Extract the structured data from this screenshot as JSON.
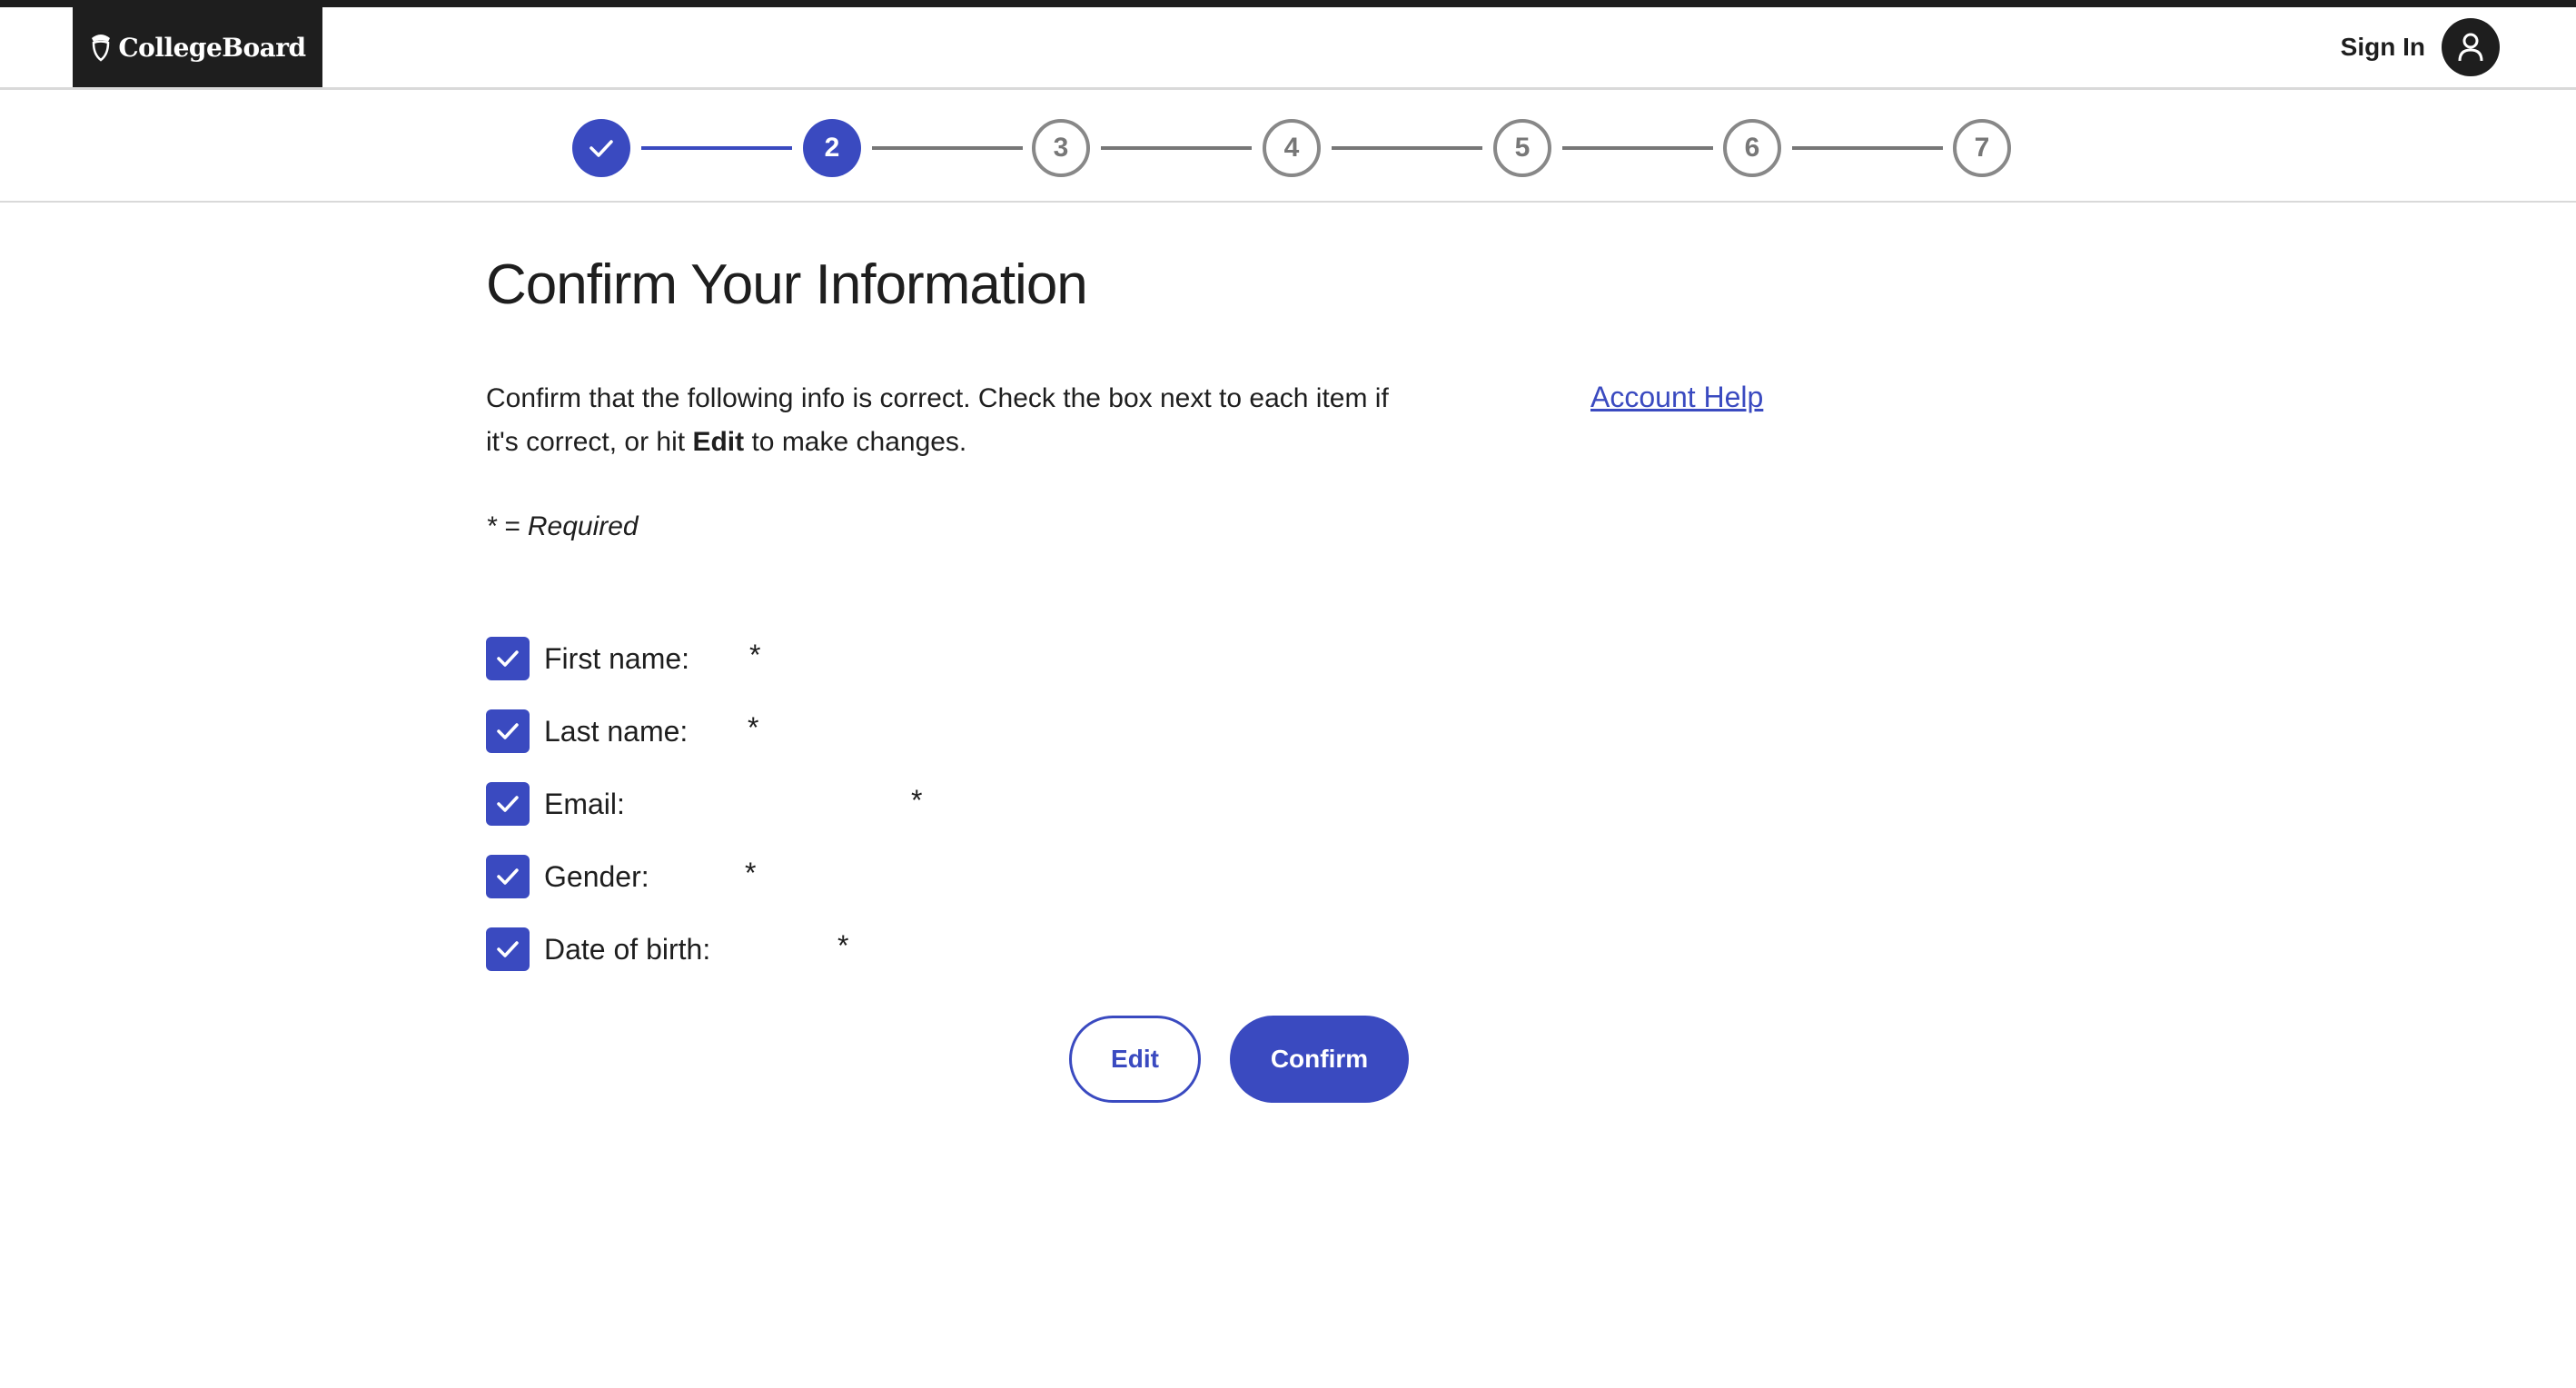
{
  "header": {
    "logo_text": "CollegeBoard",
    "sign_in_label": "Sign In"
  },
  "stepper": {
    "current_step": 2,
    "total_steps": 7,
    "steps": [
      {
        "label": "",
        "state": "done"
      },
      {
        "label": "2",
        "state": "current"
      },
      {
        "label": "3",
        "state": "future"
      },
      {
        "label": "4",
        "state": "future"
      },
      {
        "label": "5",
        "state": "future"
      },
      {
        "label": "6",
        "state": "future"
      },
      {
        "label": "7",
        "state": "future"
      }
    ]
  },
  "main": {
    "title": "Confirm Your Information",
    "intro_part1": "Confirm that the following info is correct. Check the box next to each item if it's correct, or hit ",
    "intro_bold": "Edit",
    "intro_part2": " to make changes.",
    "account_help_link": "Account Help",
    "required_note": "* = Required",
    "items": [
      {
        "label": "First name:",
        "value": "",
        "required_mark": "*",
        "checked": true
      },
      {
        "label": "Last name:",
        "value": "",
        "required_mark": "*",
        "checked": true
      },
      {
        "label": "Email:",
        "value": "",
        "required_mark": "*",
        "checked": true
      },
      {
        "label": "Gender:",
        "value": "",
        "required_mark": "*",
        "checked": true
      },
      {
        "label": "Date of birth:",
        "value": "",
        "required_mark": "*",
        "checked": true
      }
    ],
    "edit_button": "Edit",
    "confirm_button": "Confirm"
  },
  "colors": {
    "brand_blue": "#3a4ac0",
    "dark": "#1e1e1e",
    "inactive_gray": "#777777"
  }
}
